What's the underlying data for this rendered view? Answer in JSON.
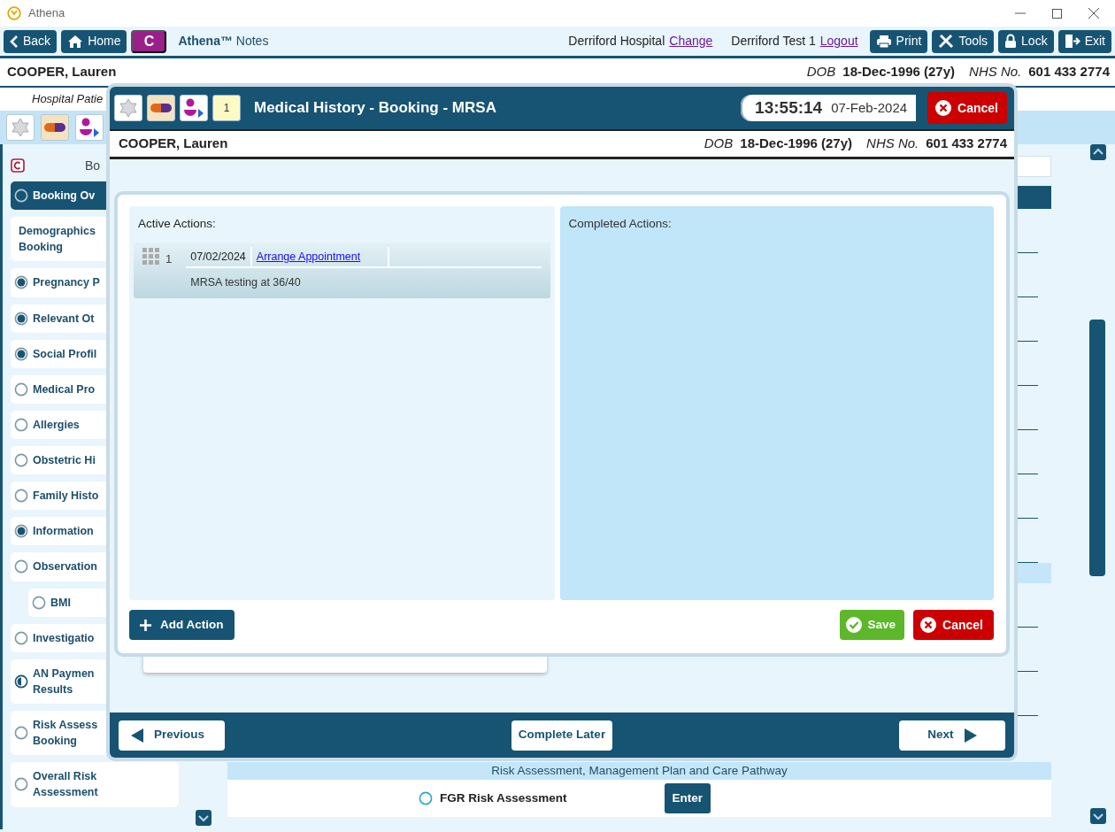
{
  "window": {
    "title": "Athena"
  },
  "toolbar": {
    "nav_buttons": [
      {
        "label": "Back"
      },
      {
        "label": "Home"
      }
    ],
    "c_badge": "C",
    "app_name": "**Athena™** Notes",
    "location": "Derriford Hospital",
    "change_link": "Change",
    "user": "Derriford Test 1",
    "logout_link": "Logout",
    "action_buttons": [
      {
        "label": "Print"
      },
      {
        "label": "Tools"
      },
      {
        "label": "Lock"
      },
      {
        "label": "Exit"
      }
    ]
  },
  "patient": {
    "name": "COOPER, Lauren",
    "dob_label": "DOB",
    "dob": "18-Dec-1996 (27y)",
    "nhs_label": "NHS No.",
    "nhs": "601 433 2774"
  },
  "subheader": "Hospital Patie",
  "sidebar": {
    "header": "Bo",
    "items": [
      {
        "label": "Booking Ov",
        "checked": false,
        "partial": false,
        "selected": true
      },
      {
        "label": "Demographics\nBooking",
        "selected": false
      },
      {
        "label": "Pregnancy P",
        "checked": true,
        "partial": false,
        "selected": false
      },
      {
        "label": "Relevant Ot",
        "checked": true,
        "partial": false,
        "selected": false
      },
      {
        "label": "Social Profil",
        "checked": true,
        "partial": false,
        "selected": false
      },
      {
        "label": "Medical Pro",
        "checked": false,
        "partial": false,
        "selected": false
      },
      {
        "label": "Allergies",
        "checked": false,
        "partial": false,
        "selected": false
      },
      {
        "label": "Obstetric Hi",
        "checked": false,
        "partial": false,
        "selected": false
      },
      {
        "label": "Family Histo",
        "checked": false,
        "partial": false,
        "selected": false
      },
      {
        "label": "Information",
        "checked": true,
        "partial": false,
        "selected": false
      },
      {
        "label": "Observation",
        "checked": false,
        "partial": false,
        "selected": false,
        "children": [
          {
            "label": "BMI",
            "checked": false,
            "partial": false,
            "selected": false
          }
        ]
      },
      {
        "label": "Investigatio",
        "checked": false,
        "partial": false,
        "selected": false
      },
      {
        "label": "AN Paymen\nResults",
        "checked": false,
        "partial": true,
        "selected": false
      },
      {
        "label": "Risk Assess\nBooking",
        "checked": false,
        "partial": false,
        "selected": false
      },
      {
        "label": "Overall Risk\nAssessment",
        "checked": false,
        "partial": false,
        "selected": false
      }
    ]
  },
  "main": {
    "band_title": "Risk Assessment, Management Plan and Care Pathway",
    "rows": [
      {
        "label": "FGR Risk Assessment",
        "checked": false,
        "button": "Enter"
      }
    ]
  },
  "modal": {
    "title": "Medical History - Booking - MRSA",
    "notepad_count": "1",
    "time": "13:55:14",
    "date": "07-Feb-2024",
    "cancel": "Cancel",
    "patient": {
      "name": "COOPER, Lauren",
      "dob_label": "DOB",
      "dob": "18-Dec-1996 (27y)",
      "nhs_label": "NHS No.",
      "nhs": "601 433 2774"
    },
    "active_title": "Active Actions:",
    "actions": [
      {
        "number": "1",
        "date": "07/02/2024",
        "link": "Arrange Appointment",
        "description": "MRSA testing at 36/40"
      }
    ],
    "completed_title": "Completed Actions:",
    "add_button": "Add Action",
    "save_button": "Save",
    "cancel_button": "Cancel",
    "footer": {
      "previous": "Previous",
      "complete_later": "Complete Later",
      "next": "Next"
    }
  }
}
